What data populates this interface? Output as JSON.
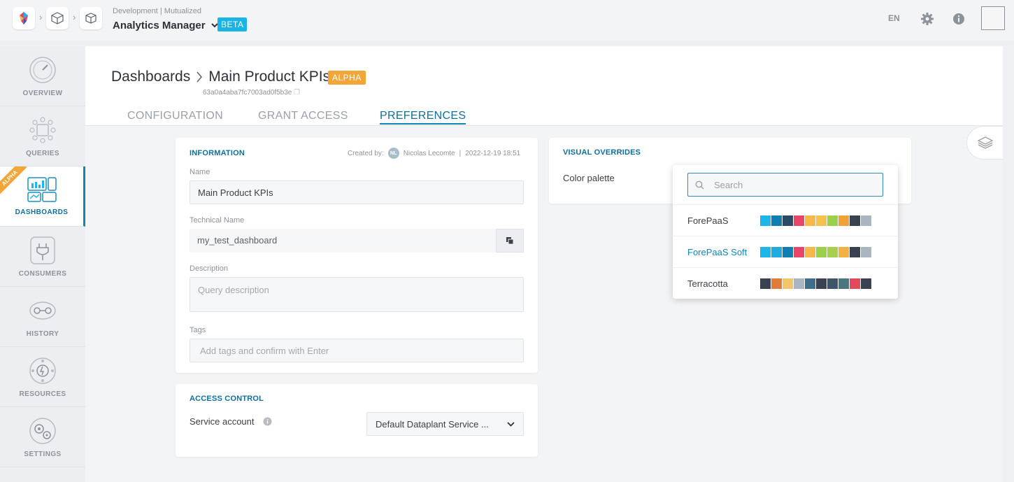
{
  "topbar": {
    "env_label": "Development | Mutualized",
    "app_title": "Analytics Manager",
    "beta_label": "BETA",
    "lang": "EN"
  },
  "sidebar": {
    "items": [
      {
        "label": "OVERVIEW",
        "icon": "gauge-icon"
      },
      {
        "label": "QUERIES",
        "icon": "queries-icon"
      },
      {
        "label": "DASHBOARDS",
        "icon": "dashboards-icon",
        "active": true,
        "ribbon": "ALPHA"
      },
      {
        "label": "CONSUMERS",
        "icon": "plug-icon"
      },
      {
        "label": "HISTORY",
        "icon": "history-icon"
      },
      {
        "label": "RESOURCES",
        "icon": "resources-icon"
      },
      {
        "label": "SETTINGS",
        "icon": "gear-icon"
      }
    ]
  },
  "header": {
    "breadcrumb_root": "Dashboards",
    "dashboard_name": "Main Product KPIs",
    "alpha_label": "ALPHA",
    "technical_id": "63a0a4aba7fc7003ad0f5b3e",
    "tabs": [
      {
        "label": "CONFIGURATION",
        "active": false
      },
      {
        "label": "GRANT ACCESS",
        "active": false
      },
      {
        "label": "PREFERENCES",
        "active": true
      }
    ]
  },
  "information": {
    "title": "INFORMATION",
    "created_by_label": "Created by:",
    "author_initials": "NL",
    "author_name": "Nicolas Lecomte",
    "separator": "|",
    "created_at": "2022-12-19 18:51",
    "name_label": "Name",
    "name_value": "Main Product KPIs",
    "tech_name_label": "Technical Name",
    "tech_name_value": "my_test_dashboard",
    "description_label": "Description",
    "description_placeholder": "Query description",
    "tags_label": "Tags",
    "tags_placeholder": "Add tags and confirm with Enter"
  },
  "access_control": {
    "title": "ACCESS CONTROL",
    "service_account_label": "Service account",
    "service_account_value": "Default Dataplant Service ..."
  },
  "visual_overrides": {
    "title": "VISUAL OVERRIDES",
    "color_palette_label": "Color palette"
  },
  "palette_dropdown": {
    "search_placeholder": "Search",
    "options": [
      {
        "name": "ForePaaS",
        "colors": [
          "#1eb5e8",
          "#0f7fb3",
          "#2a4a66",
          "#e8456a",
          "#f7b84a",
          "#f2c14e",
          "#9ad149",
          "#f0a13a",
          "#3a4150",
          "#aab5bf"
        ]
      },
      {
        "name": "ForePaaS Soft",
        "selected": true,
        "colors": [
          "#1eb5e8",
          "#22a9de",
          "#0f7fb3",
          "#e8456a",
          "#f7b84a",
          "#9ad149",
          "#a7d14c",
          "#f2b144",
          "#3a4150",
          "#aab5bf"
        ]
      },
      {
        "name": "Terracotta",
        "colors": [
          "#3a4150",
          "#e07b39",
          "#f2c56b",
          "#aab5bf",
          "#3d6e8a",
          "#3a4150",
          "#3d5566",
          "#4a7682",
          "#e04a5a",
          "#3a4150"
        ]
      }
    ]
  }
}
